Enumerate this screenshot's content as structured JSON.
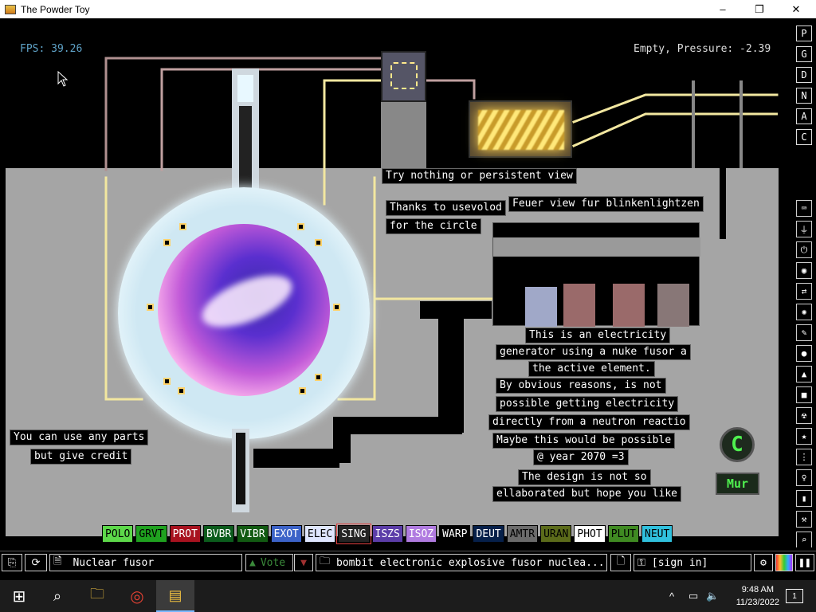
{
  "window": {
    "title": "The Powder Toy",
    "minimize": "–",
    "maximize": "❐",
    "close": "✕"
  },
  "hud": {
    "fps": "FPS: 39.26",
    "pressure": "Empty, Pressure: -2.39"
  },
  "labels": {
    "persistent": "Try nothing or persistent view",
    "feuer": "Feuer view fur blinkenlightzen",
    "thanks1": "Thanks to usevolod",
    "thanks2": "for the circle",
    "credit1": "You can use any parts",
    "credit2": "but give credit",
    "desc1": "This is an electricity",
    "desc2": "generator using a nuke fusor a",
    "desc3": "the active element.",
    "desc4": "By obvious reasons, is not",
    "desc5": "possible getting electricity",
    "desc6": "directly from a neutron reactio",
    "desc7": "Maybe this would be possible",
    "desc8": "@ year 2070 =3",
    "desc9": "The design is not so",
    "desc10": "ellaborated but hope you like",
    "logo_c": "C",
    "logo_mur": "Mur"
  },
  "sidebar_modes": [
    "P",
    "G",
    "D",
    "N",
    "A",
    "C"
  ],
  "tool_icons": [
    "keyboard-icon",
    "plug-icon",
    "power-icon",
    "gauge-icon",
    "arrows-icon",
    "spray-icon",
    "brush-icon",
    "drop-icon",
    "warning-icon",
    "box-icon",
    "radiation-icon",
    "star-icon",
    "dots-icon",
    "bulb-icon",
    "bookmark-icon",
    "hammer-icon",
    "search-icon"
  ],
  "tool_glyphs": [
    "⌨",
    "⏚",
    "⏻",
    "◉",
    "⇄",
    "✺",
    "✎",
    "●",
    "▲",
    "■",
    "☢",
    "★",
    "⋮",
    "♀",
    "▮",
    "⚒",
    "⌕"
  ],
  "elements": [
    {
      "name": "POLO",
      "bg": "#5dd84a",
      "fg": "#000"
    },
    {
      "name": "GRVT",
      "bg": "#1fa11f",
      "fg": "#000"
    },
    {
      "name": "PROT",
      "bg": "#a8121f",
      "fg": "#fff"
    },
    {
      "name": "BVBR",
      "bg": "#0b5c1c",
      "fg": "#fff"
    },
    {
      "name": "VIBR",
      "bg": "#125a12",
      "fg": "#fff"
    },
    {
      "name": "EXOT",
      "bg": "#3c63c8",
      "fg": "#fff"
    },
    {
      "name": "ELEC",
      "bg": "#dfe6ff",
      "fg": "#000"
    },
    {
      "name": "SING",
      "bg": "#242424",
      "fg": "#fff",
      "selected": true
    },
    {
      "name": "ISZS",
      "bg": "#5b3da8",
      "fg": "#fff"
    },
    {
      "name": "ISOZ",
      "bg": "#b07be0",
      "fg": "#fff"
    },
    {
      "name": "WARP",
      "bg": "#000000",
      "fg": "#fff"
    },
    {
      "name": "DEUT",
      "bg": "#06204a",
      "fg": "#fff"
    },
    {
      "name": "AMTR",
      "bg": "#6b6b6b",
      "fg": "#000"
    },
    {
      "name": "URAN",
      "bg": "#5b6b1a",
      "fg": "#000"
    },
    {
      "name": "PHOT",
      "bg": "#ffffff",
      "fg": "#000"
    },
    {
      "name": "PLUT",
      "bg": "#3f8a22",
      "fg": "#000"
    },
    {
      "name": "NEUT",
      "bg": "#30c0dd",
      "fg": "#000"
    }
  ],
  "bottombar": {
    "open_icon": "⎘",
    "reload_icon": "⟳",
    "save_icon": "🗎",
    "save_name": "Nuclear fusor",
    "vote_label": "Vote",
    "vote_up": "▲",
    "vote_down": "▼",
    "tags_icon": "🗀",
    "tags": "bombit electronic explosive fusor nuclea...",
    "new_icon": "🗋",
    "login_icon": "⚿",
    "login": "[sign in]",
    "settings_icon": "⚙",
    "pause_icon": "❚❚"
  },
  "taskbar": {
    "start_icon": "⊞",
    "search_icon": "⌕",
    "explorer_icon": "🗀",
    "chrome_icon": "◎",
    "powdertoy_icon": "▤",
    "tray_up": "^",
    "tray_net": "▭",
    "tray_sound": "🔈",
    "time": "9:48 AM",
    "date": "11/23/2022",
    "notif": "1"
  }
}
